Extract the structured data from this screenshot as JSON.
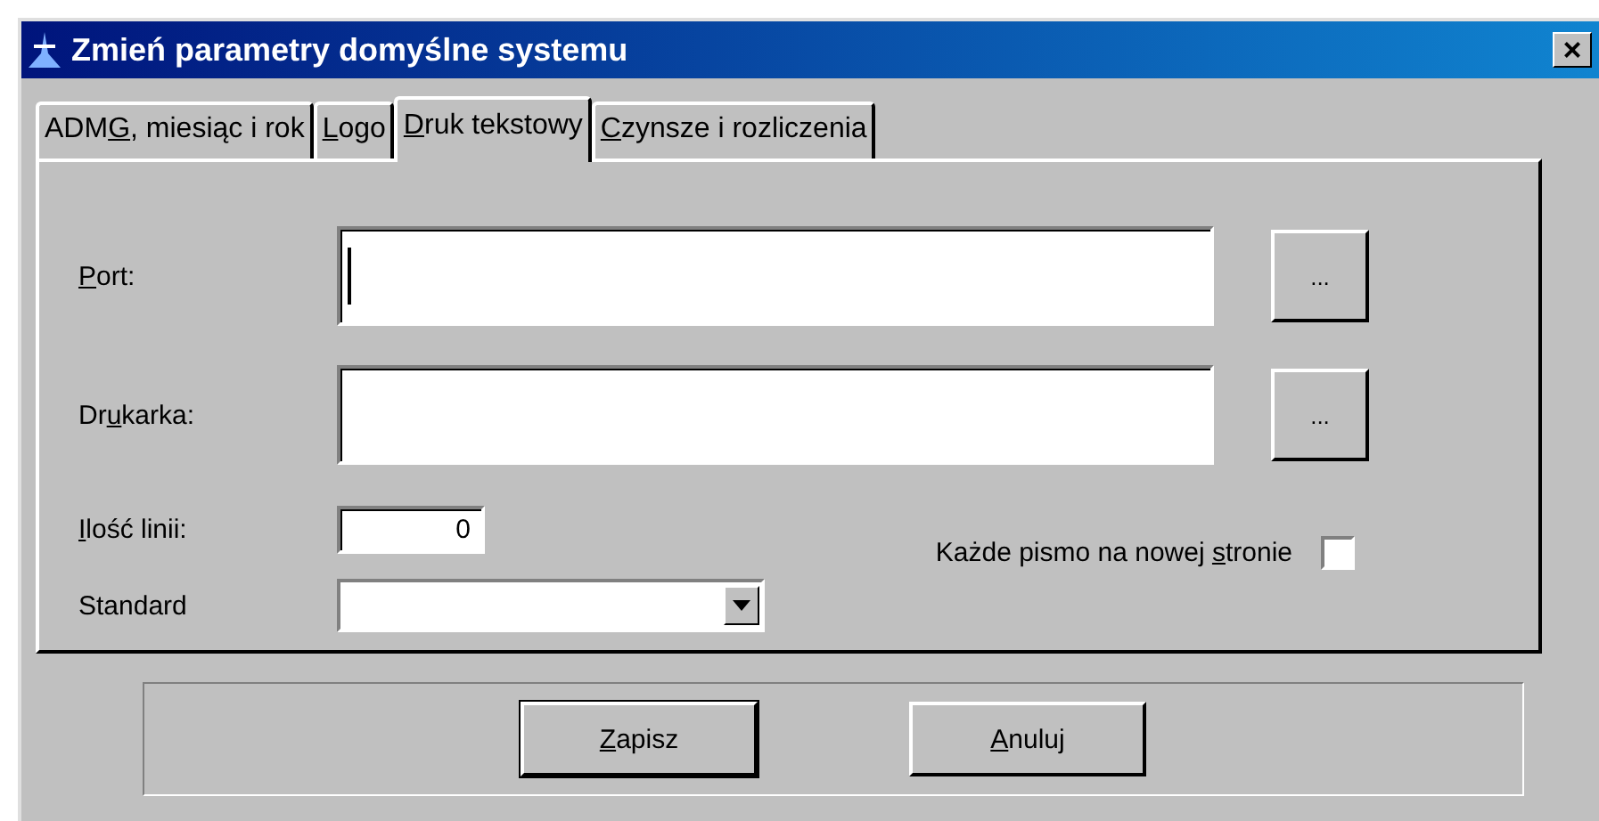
{
  "window": {
    "title": "Zmień parametry domyślne systemu",
    "close": "×"
  },
  "tabs": [
    {
      "label": {
        "pre": "ADM",
        "key": "G",
        "post": ", miesiąc i rok"
      },
      "selected": false
    },
    {
      "label": {
        "key": "L",
        "post": "ogo"
      },
      "selected": false
    },
    {
      "label": {
        "key": "D",
        "post": "ruk tekstowy"
      },
      "selected": true
    },
    {
      "label": {
        "key": "C",
        "post": "zynsze i rozliczenia"
      },
      "selected": false
    }
  ],
  "port": {
    "label": {
      "key": "P",
      "post": "ort:"
    },
    "focused": true,
    "browse": "..."
  },
  "printer": {
    "label": {
      "pre": "Dr",
      "key": "u",
      "post": "karka:"
    },
    "focused": false,
    "browse": "..."
  },
  "lines": {
    "label": {
      "key": "I",
      "post": "lość linii:"
    },
    "value": "0"
  },
  "standard": {
    "label": {
      "pre": "Standard"
    }
  },
  "new_page": {
    "label": {
      "pre": "Każde pismo na nowej ",
      "key": "s",
      "post": "tronie"
    },
    "checked": false
  },
  "buttons": [
    {
      "label": {
        "key": "Z",
        "post": "apisz"
      },
      "default": true
    },
    {
      "label": {
        "key": "A",
        "post": "nuluj"
      },
      "default": false
    }
  ]
}
